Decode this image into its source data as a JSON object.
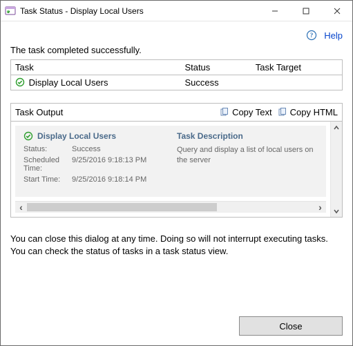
{
  "window": {
    "title": "Task Status - Display Local Users"
  },
  "help": {
    "label": "Help"
  },
  "status_message": "The task completed successfully.",
  "table": {
    "headers": {
      "task": "Task",
      "status": "Status",
      "target": "Task Target"
    },
    "row": {
      "task": "Display Local Users",
      "status": "Success",
      "target": ""
    }
  },
  "output": {
    "label": "Task Output",
    "copy_text": "Copy Text",
    "copy_html": "Copy HTML",
    "task_title": "Display Local Users",
    "desc_header": "Task Description",
    "description": "Query and display a list of local users on the server",
    "kv": {
      "status_label": "Status:",
      "status_value": "Success",
      "scheduled_label": "Scheduled Time:",
      "scheduled_value": "9/25/2016 9:18:13 PM",
      "start_label": "Start Time:",
      "start_value": "9/25/2016 9:18:14 PM"
    }
  },
  "note": "You can close this dialog at any time. Doing so will not interrupt executing tasks. You can check the status of tasks in a task status view.",
  "buttons": {
    "close": "Close"
  }
}
